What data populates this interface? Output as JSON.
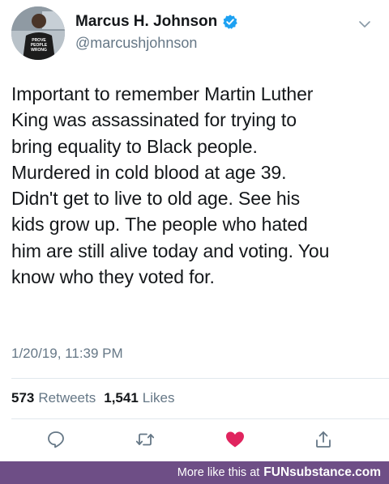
{
  "profile": {
    "display_name": "Marcus H. Johnson",
    "handle": "@marcushjohnson",
    "avatar_shirt_text": "PROVE PEOPLE WRONG"
  },
  "tweet": {
    "text": "Important to remember Martin Luther\nKing was assassinated for trying to\nbring equality to Black people.\nMurdered in cold blood at age 39.\nDidn't get to live to old age. See his\nkids grow up. The people who hated\nhim are still alive today and voting. You\nknow who they voted for.",
    "timestamp": "1/20/19, 11:39 PM"
  },
  "stats": {
    "retweets_count": "573",
    "retweets_label": "Retweets",
    "likes_count": "1,541",
    "likes_label": "Likes"
  },
  "actions": {
    "reply_icon": "reply-icon",
    "retweet_icon": "retweet-icon",
    "like_icon": "heart-icon",
    "share_icon": "share-icon",
    "like_color": "#e0245e"
  },
  "footer": {
    "prefix": "More like this at",
    "brand": "FUNsubstance.com"
  },
  "colors": {
    "verified": "#1da1f2",
    "muted_text": "#657786",
    "footer_bg": "#6e4e86"
  }
}
